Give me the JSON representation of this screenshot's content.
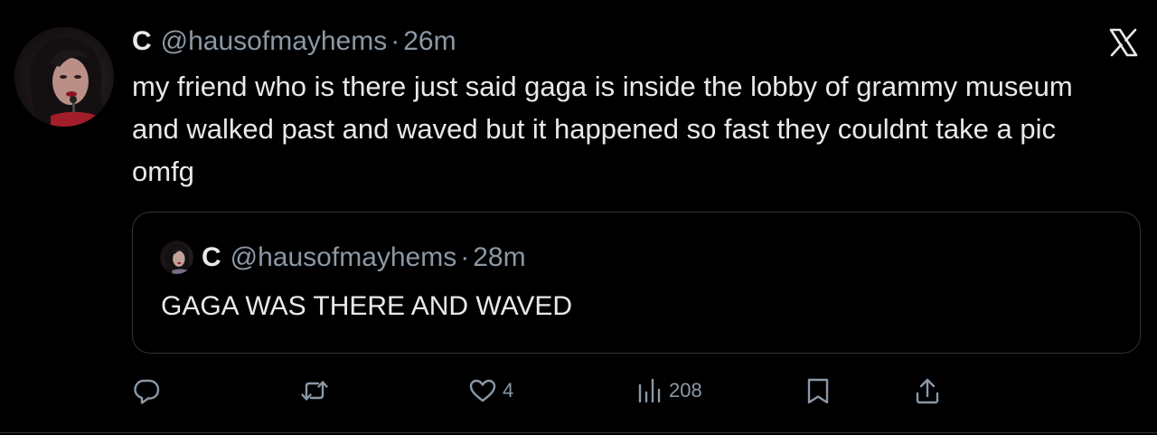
{
  "tweet": {
    "author": {
      "display_name": "C",
      "handle": "@hausofmayhems",
      "separator": "·",
      "time": "26m"
    },
    "text": "my friend who is there just said gaga is inside the lobby of grammy museum and walked past and waved but it happened so fast they couldnt take a pic omfg",
    "platform_icon": "x-logo-icon"
  },
  "quoted_tweet": {
    "author": {
      "display_name": "C",
      "handle": "@hausofmayhems",
      "separator": "·",
      "time": "28m"
    },
    "text": "GAGA WAS THERE AND WAVED"
  },
  "actions": {
    "reply": {
      "icon": "reply-icon",
      "count": ""
    },
    "repost": {
      "icon": "repost-icon",
      "count": ""
    },
    "like": {
      "icon": "heart-icon",
      "count": "4"
    },
    "views": {
      "icon": "views-icon",
      "count": "208"
    },
    "bookmark": {
      "icon": "bookmark-icon"
    },
    "share": {
      "icon": "share-icon"
    }
  },
  "colors": {
    "background": "#000000",
    "text_primary": "#e7e9ea",
    "text_secondary": "#8b98a5",
    "border": "#2f3336"
  }
}
